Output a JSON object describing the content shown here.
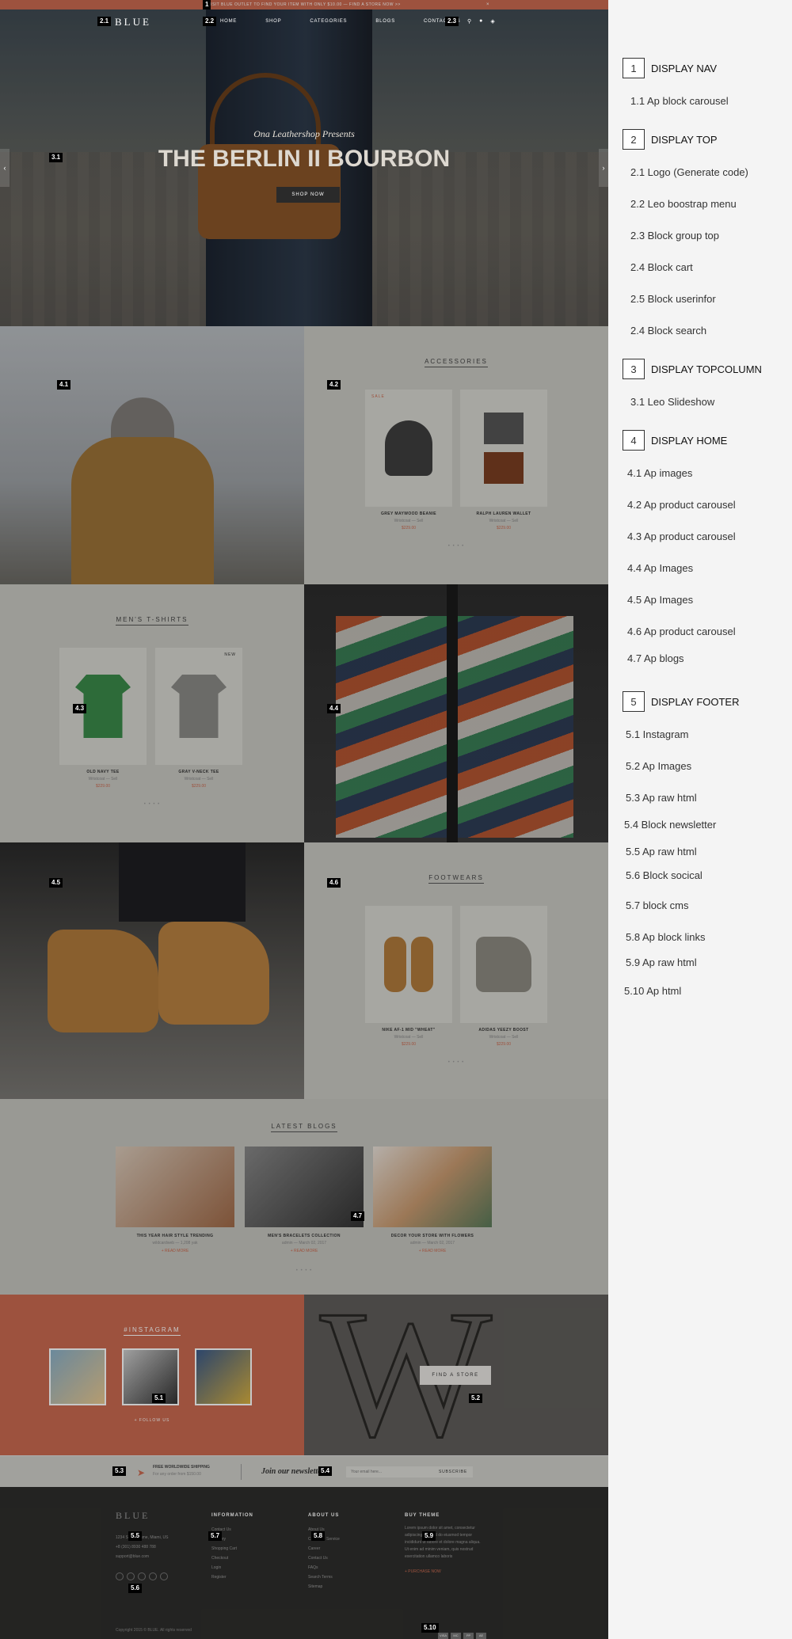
{
  "topbar": {
    "text": "VISIT BLUE OUTLET TO FIND YOUR ITEM WITH ONLY $10.00 — FIND A STORE NOW >>",
    "close": "×"
  },
  "nav": {
    "logo": "BLUE",
    "menu": [
      "HOME",
      "SHOP",
      "CATEGORIES",
      "BLOGS",
      "CONTACT US"
    ],
    "icons": [
      "search-icon",
      "user-icon",
      "cart-icon"
    ]
  },
  "hero": {
    "subtitle": "Ona Leathershop Presents",
    "title": "THE BERLIN II BOURBON",
    "button": "SHOP NOW",
    "prev": "‹",
    "next": "›"
  },
  "accessories": {
    "title": "ACCESSORIES",
    "products": [
      {
        "tag": "SALE",
        "name": "GREY MAYWOOD BEANIE",
        "meta": "Wristcoat — Sell",
        "price": "$229.00"
      },
      {
        "tag": "",
        "name": "RALPH LAUREN WALLET",
        "meta": "Wristcoat — Sell",
        "price": "$229.00"
      }
    ]
  },
  "tshirts": {
    "title": "MEN'S T-SHIRTS",
    "products": [
      {
        "tag": "",
        "name": "OLD NAVY TEE",
        "meta": "Wristcoat — Sell",
        "price": "$229.00"
      },
      {
        "tag": "NEW",
        "name": "GRAY V-NECK TEE",
        "meta": "Wristcoat — Sell",
        "price": "$229.00"
      }
    ]
  },
  "footwears": {
    "title": "FOOTWEARS",
    "products": [
      {
        "tag": "",
        "name": "NIKE AF-1 MID \"WHEAT\"",
        "meta": "Wristcoat — Sell",
        "price": "$229.00"
      },
      {
        "tag": "",
        "name": "ADIDAS YEEZY BOOST",
        "meta": "Wristcoat — Sell",
        "price": "$229.00"
      }
    ]
  },
  "dots": "• • • •",
  "blogs": {
    "title": "LATEST BLOGS",
    "items": [
      {
        "title": "THIS YEAR HAIR STYLE TRENDING",
        "meta": "wildcardweb — 1,208 yak",
        "more": "+ READ MORE"
      },
      {
        "title": "MEN'S BRACELETS COLLECTION",
        "meta": "admin — March 02, 2017",
        "more": "+ READ MORE"
      },
      {
        "title": "DECOR YOUR STORE WITH FLOWERS",
        "meta": "admin — March 02, 2017",
        "more": "+ READ MORE"
      }
    ]
  },
  "instagram": {
    "title": "#INSTAGRAM",
    "follow": "+ FOLLOW US"
  },
  "store": {
    "button": "FIND A STORE"
  },
  "newsletter": {
    "shipping_title": "FREE WORLDWIDE SHIPPING",
    "shipping_sub": "For any order from $150.00",
    "join": "Join our newsletter",
    "placeholder": "Your email here...",
    "subscribe": "SUBSCRIBE"
  },
  "footer": {
    "logo": "BLUE",
    "address": [
      "1234 Street Name, Miami, US",
      "+8 (301) 8930 488 788",
      "support@blue.com"
    ],
    "information": {
      "title": "INFORMATION",
      "links": [
        "Contact Us",
        "Delivery",
        "Shopping Cart",
        "Checkout",
        "Login",
        "Register"
      ]
    },
    "about": {
      "title": "ABOUT US",
      "links": [
        "About Us",
        "Customer Service",
        "Career",
        "Contact Us",
        "FAQs",
        "Search Terms",
        "Sitemap"
      ]
    },
    "buy": {
      "title": "BUY THEME",
      "text": [
        "Lorem ipsum dolor sit amet, consectetur",
        "adipiscing elit, sed do eiusmod tempor",
        "incididunt ut labore et dolore magna aliqua.",
        "Ut enim ad minim veniam, quis nostrud",
        "exercitation ullamco laboris"
      ],
      "link": "+ PURCHASE NOW"
    },
    "copyright": "Copyright 2015 © BLUE. All rights reserved",
    "payments": [
      "VISA",
      "MC",
      "PP",
      "AE"
    ]
  },
  "badges": [
    "1",
    "2.1",
    "2.2",
    "2.3",
    "3.1",
    "4.1",
    "4.2",
    "4.3",
    "4.4",
    "4.5",
    "4.6",
    "4.7",
    "5.1",
    "5.2",
    "5.3",
    "5.4",
    "5.5",
    "5.6",
    "5.7",
    "5.8",
    "5.9",
    "5.10"
  ],
  "legend": [
    {
      "num": "1",
      "title": "DISPLAY NAV",
      "items": [
        "1.1  Ap block carousel"
      ]
    },
    {
      "num": "2",
      "title": "DISPLAY TOP",
      "items": [
        "2.1 Logo (Generate code)",
        "2.2 Leo boostrap menu",
        "2.3 Block group top",
        "2.4 Block cart",
        "2.5 Block userinfor",
        "2.4 Block search"
      ]
    },
    {
      "num": "3",
      "title": "DISPLAY TOPCOLUMN",
      "items": [
        "3.1 Leo Slideshow"
      ]
    },
    {
      "num": "4",
      "title": "DISPLAY HOME",
      "items": [
        "4.1 Ap images",
        "4.2 Ap  product carousel",
        "4.3  Ap  product carousel",
        "4.4  Ap  Images",
        "4.5 Ap  Images",
        "4.6 Ap product carousel",
        "4.7 Ap blogs"
      ]
    },
    {
      "num": "5",
      "title": "DISPLAY FOOTER",
      "items": [
        "5.1 Instagram",
        "5.2 Ap  Images",
        "5.3 Ap raw html",
        "5.4 Block newsletter",
        "5.5 Ap raw html",
        "5.6 Block socical",
        "5.7 block cms",
        "5.8 Ap block links",
        "5.9 Ap raw html",
        "5.10 Ap  html"
      ]
    }
  ]
}
